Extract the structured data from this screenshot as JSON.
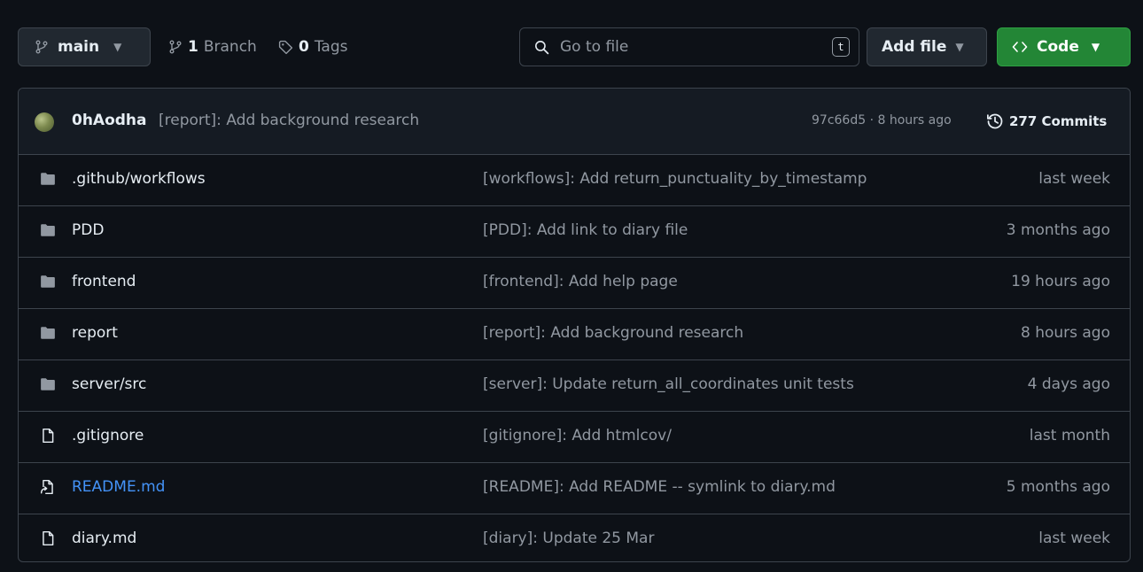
{
  "toolbar": {
    "branch": "main",
    "branches_count": "1",
    "branches_label": "Branch",
    "tags_count": "0",
    "tags_label": "Tags",
    "search_placeholder": "Go to file",
    "search_shortcut": "t",
    "add_file_label": "Add file",
    "code_label": "Code"
  },
  "latest_commit": {
    "author": "0hAodha",
    "message": "[report]: Add background research",
    "hash_time": "97c66d5 · 8 hours ago",
    "commits_label": "277 Commits"
  },
  "files": [
    {
      "name": ".github/workflows",
      "type": "folder",
      "message": "[workflows]: Add return_punctuality_by_timestamp",
      "time": "last week"
    },
    {
      "name": "PDD",
      "type": "folder",
      "message": "[PDD]: Add link to diary file",
      "time": "3 months ago"
    },
    {
      "name": "frontend",
      "type": "folder",
      "message": "[frontend]: Add help page",
      "time": "19 hours ago"
    },
    {
      "name": "report",
      "type": "folder",
      "message": "[report]: Add background research",
      "time": "8 hours ago"
    },
    {
      "name": "server/src",
      "type": "folder",
      "message": "[server]: Update return_all_coordinates unit tests",
      "time": "4 days ago"
    },
    {
      "name": ".gitignore",
      "type": "file",
      "message": "[gitignore]: Add htmlcov/",
      "time": "last month"
    },
    {
      "name": "README.md",
      "type": "symlink",
      "message": "[README]: Add README -- symlink to diary.md",
      "time": "5 months ago"
    },
    {
      "name": "diary.md",
      "type": "file",
      "message": "[diary]: Update 25 Mar",
      "time": "last week"
    }
  ],
  "colors": {
    "background": "#0d1117",
    "header_bg": "#151b23",
    "border": "#3d444d",
    "muted_text": "#9198a1",
    "link": "#4493f8",
    "code_button": "#238636"
  }
}
